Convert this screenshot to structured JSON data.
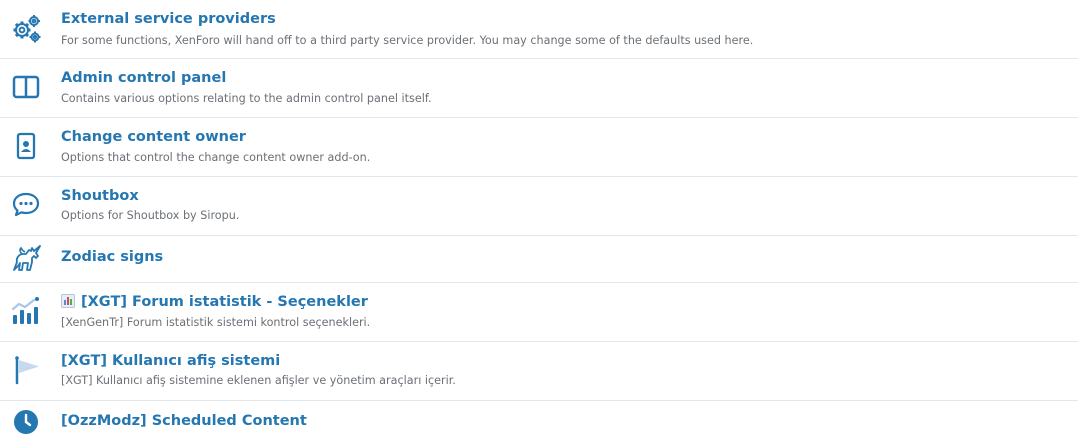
{
  "options": [
    {
      "title": "External service providers",
      "description": "For some functions, XenForo will hand off to a third party service provider. You may change some of the defaults used here.",
      "icon": "gears-icon"
    },
    {
      "title": "Admin control panel",
      "description": "Contains various options relating to the admin control panel itself.",
      "icon": "columns-icon"
    },
    {
      "title": "Change content owner",
      "description": "Options that control the change content owner add-on.",
      "icon": "id-badge-icon"
    },
    {
      "title": "Shoutbox",
      "description": "Options for Shoutbox by Siropu.",
      "icon": "comment-dots-icon"
    },
    {
      "title": "Zodiac signs",
      "description": "",
      "icon": "unicorn-icon"
    },
    {
      "title": "[XGT] Forum istatistik - Seçenekler",
      "description": "[XenGenTr] Forum istatistik sistemi kontrol seçenekleri.",
      "icon": "chart-mixed-icon",
      "title_emoji": "bar-chart-emoji"
    },
    {
      "title": "[XGT] Kullanıcı afiş sistemi",
      "description": "[XGT] Kullanıcı afiş sistemine eklenen afişler ve yönetim araçları içerir.",
      "icon": "flag-pennant-icon"
    },
    {
      "title": "[OzzModz] Scheduled Content",
      "description": "",
      "icon": "clock-icon"
    }
  ],
  "colors": {
    "title": "#2577b1",
    "description": "#6b7076",
    "icon": "#2577b1",
    "icon_light": "#a9c6e6",
    "divider": "#e3e6ea"
  }
}
